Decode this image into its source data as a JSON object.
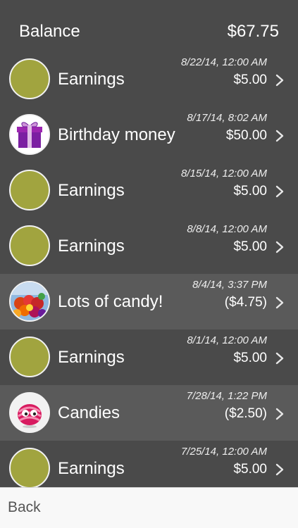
{
  "header": {
    "title": "Balance",
    "balance": "$67.75"
  },
  "colors": {
    "background": "#4a4a4a",
    "row_highlight": "#5a5a5a",
    "earnings_circle": "#a1a43f",
    "footer_background": "#f8f8f8"
  },
  "transactions": [
    {
      "label": "Earnings",
      "date": "8/22/14, 12:00 AM",
      "amount": "$5.00",
      "icon": "earnings-circle-icon"
    },
    {
      "label": "Birthday money",
      "date": "8/17/14, 8:02 AM",
      "amount": "$50.00",
      "icon": "gift-icon"
    },
    {
      "label": "Earnings",
      "date": "8/15/14, 12:00 AM",
      "amount": "$5.00",
      "icon": "earnings-circle-icon"
    },
    {
      "label": "Earnings",
      "date": "8/8/14, 12:00 AM",
      "amount": "$5.00",
      "icon": "earnings-circle-icon"
    },
    {
      "label": "Lots of candy!",
      "date": "8/4/14, 3:37 PM",
      "amount": "($4.75)",
      "icon": "candy-photo-icon"
    },
    {
      "label": "Earnings",
      "date": "8/1/14, 12:00 AM",
      "amount": "$5.00",
      "icon": "earnings-circle-icon"
    },
    {
      "label": "Candies",
      "date": "7/28/14, 1:22 PM",
      "amount": "($2.50)",
      "icon": "candy-character-icon"
    },
    {
      "label": "Earnings",
      "date": "7/25/14, 12:00 AM",
      "amount": "$5.00",
      "icon": "earnings-circle-icon"
    }
  ],
  "footer": {
    "back_label": "Back"
  }
}
